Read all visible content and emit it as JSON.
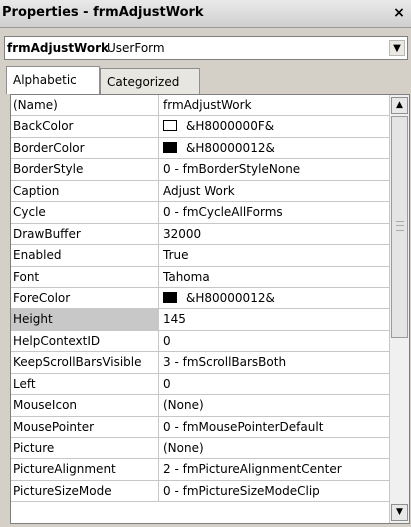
{
  "window": {
    "title": "Properties - frmAdjustWork",
    "close_glyph": "×"
  },
  "object_selector": {
    "name": "frmAdjustWork",
    "type": "UserForm",
    "arrow_glyph": "▼"
  },
  "tabs": [
    {
      "label": "Alphabetic",
      "active": true
    },
    {
      "label": "Categorized",
      "active": false
    }
  ],
  "properties": [
    {
      "name": "(Name)",
      "value": "frmAdjustWork"
    },
    {
      "name": "BackColor",
      "value": "&H8000000F&",
      "swatch": "#ffffff"
    },
    {
      "name": "BorderColor",
      "value": "&H80000012&",
      "swatch": "#000000"
    },
    {
      "name": "BorderStyle",
      "value": "0 - fmBorderStyleNone"
    },
    {
      "name": "Caption",
      "value": "Adjust Work"
    },
    {
      "name": "Cycle",
      "value": "0 - fmCycleAllForms"
    },
    {
      "name": "DrawBuffer",
      "value": "32000"
    },
    {
      "name": "Enabled",
      "value": "True"
    },
    {
      "name": "Font",
      "value": "Tahoma"
    },
    {
      "name": "ForeColor",
      "value": "&H80000012&",
      "swatch": "#000000"
    },
    {
      "name": "Height",
      "value": "145",
      "selected": true
    },
    {
      "name": "HelpContextID",
      "value": "0"
    },
    {
      "name": "KeepScrollBarsVisible",
      "value": "3 - fmScrollBarsBoth"
    },
    {
      "name": "Left",
      "value": "0"
    },
    {
      "name": "MouseIcon",
      "value": "(None)"
    },
    {
      "name": "MousePointer",
      "value": "0 - fmMousePointerDefault"
    },
    {
      "name": "Picture",
      "value": "(None)"
    },
    {
      "name": "PictureAlignment",
      "value": "2 - fmPictureAlignmentCenter"
    },
    {
      "name": "PictureSizeMode",
      "value": "0 - fmPictureSizeModeClip"
    }
  ],
  "scrollbar": {
    "up_glyph": "▲",
    "down_glyph": "▼"
  }
}
